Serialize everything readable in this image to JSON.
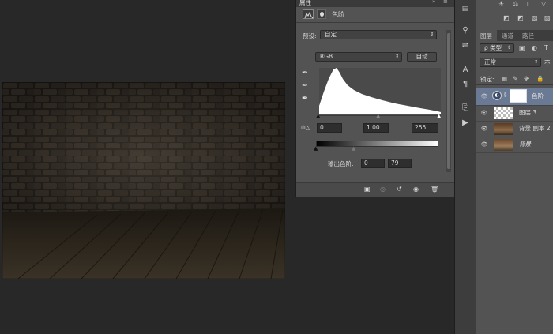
{
  "properties_panel": {
    "title": "属性",
    "collapse_icon": "double-chevron",
    "menu_icon": "panel-menu",
    "adjustment_name": "色阶",
    "preset_label": "预设:",
    "preset_value": "自定",
    "channel_value": "RGB",
    "auto_label": "自动",
    "input_black": "0",
    "input_gamma": "1.00",
    "input_white": "255",
    "output_label": "输出色阶:",
    "output_black": "0",
    "output_white": "79"
  },
  "layers_panel": {
    "tabs": [
      "图层",
      "通道",
      "路径"
    ],
    "filter_label": "ρ 类型",
    "blend_mode": "正常",
    "opacity_label": "不",
    "lock_label": "锁定:",
    "layers": [
      {
        "name": "色阶",
        "type": "adjustment",
        "selected": true
      },
      {
        "name": "图层 3",
        "type": "transparent"
      },
      {
        "name": "背景 副本 2",
        "type": "image"
      },
      {
        "name": "背景",
        "type": "image",
        "italic": true
      }
    ]
  },
  "colors": {
    "panel_bg": "#535353",
    "workspace_bg": "#282828",
    "selected_layer": "#6a7a95"
  }
}
